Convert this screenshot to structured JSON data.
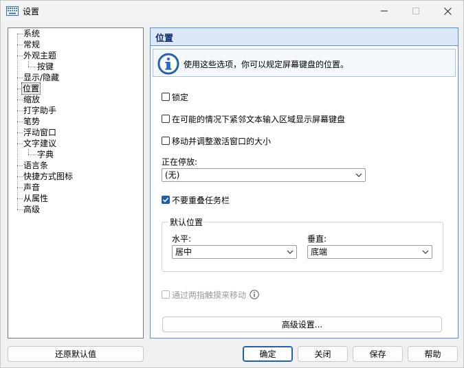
{
  "window": {
    "title": "设置"
  },
  "tree": {
    "items": [
      {
        "label": "系统"
      },
      {
        "label": "常规"
      },
      {
        "label": "外观主题"
      },
      {
        "label": "按键"
      },
      {
        "label": "显示/隐藏"
      },
      {
        "label": "位置"
      },
      {
        "label": "缩放"
      },
      {
        "label": "打字助手"
      },
      {
        "label": "笔势"
      },
      {
        "label": "浮动窗口"
      },
      {
        "label": "文字建议"
      },
      {
        "label": "字典"
      },
      {
        "label": "语言条"
      },
      {
        "label": "快捷方式图标"
      },
      {
        "label": "声音"
      },
      {
        "label": "从属性"
      },
      {
        "label": "高级"
      }
    ],
    "selected": "位置"
  },
  "panel": {
    "title": "位置",
    "info": "使用这些选项，你可以规定屏幕键盘的位置。",
    "lock_label": "锁定",
    "near_text_label": "在可能的情况下紧邻文本输入区域显示屏幕键盘",
    "resize_label": "移动并调整激活窗口的大小",
    "docking_label": "正在停放:",
    "docking_value": "(无)",
    "no_overlap_label": "不要重叠任务栏",
    "default_position_title": "默认位置",
    "horizontal_label": "水平:",
    "horizontal_value": "居中",
    "vertical_label": "垂直:",
    "vertical_value": "底端",
    "two_finger_label": "通过两指触摸来移动",
    "advanced_button": "高级设置..."
  },
  "checks": {
    "lock": false,
    "near_text": false,
    "resize": false,
    "no_overlap": true,
    "two_finger": false
  },
  "buttons": {
    "restore": "还原默认值",
    "ok": "确定",
    "close": "关闭",
    "save": "保存",
    "help": "帮助"
  },
  "colors": {
    "accent": "#1b5fb8",
    "header_bg": "#dde8f6",
    "header_text": "#0b2a74"
  }
}
